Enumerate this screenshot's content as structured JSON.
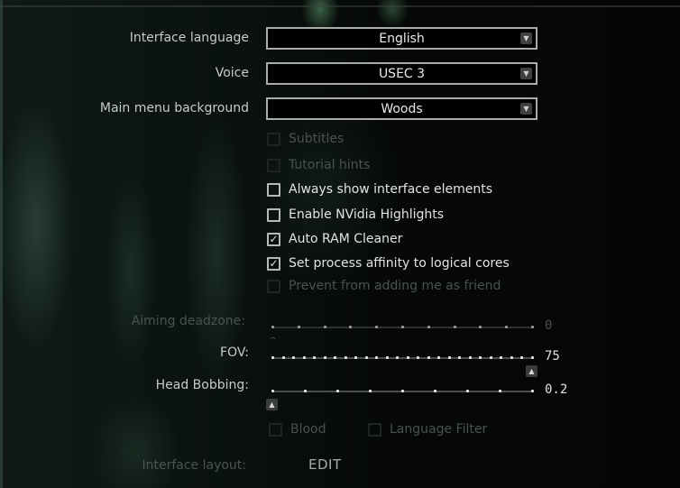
{
  "dropdowns": [
    {
      "label": "Interface language",
      "value": "English",
      "icon": "chevron-down-icon"
    },
    {
      "label": "Voice",
      "value": "USEC 3",
      "icon": "chevron-down-icon"
    },
    {
      "label": "Main menu background",
      "value": "Woods",
      "icon": "chevron-down-icon"
    }
  ],
  "checkboxes": [
    {
      "label": "Subtitles",
      "checked": false,
      "enabled": false
    },
    {
      "label": "Tutorial hints",
      "checked": false,
      "enabled": false
    },
    {
      "label": "Always show interface elements",
      "checked": false,
      "enabled": true
    },
    {
      "label": "Enable NVidia Highlights",
      "checked": false,
      "enabled": true
    },
    {
      "label": "Auto RAM Cleaner",
      "checked": true,
      "enabled": true
    },
    {
      "label": "Set process affinity to logical cores",
      "checked": true,
      "enabled": true
    },
    {
      "label": "Prevent from adding me as friend",
      "checked": false,
      "enabled": false
    }
  ],
  "check_glyph": "✓",
  "sliders": [
    {
      "label": "Aiming deadzone:",
      "value": "0",
      "ticks": 11,
      "position": 0.0,
      "enabled": false
    },
    {
      "label": "FOV:",
      "value": "75",
      "ticks": 26,
      "position": 1.0,
      "enabled": true
    },
    {
      "label": "Head Bobbing:",
      "value": "0.2",
      "ticks": 9,
      "position": 0.0,
      "enabled": true
    }
  ],
  "handle_glyph": "▲",
  "bottom_checkboxes": [
    {
      "label": "Blood",
      "checked": false,
      "enabled": false
    },
    {
      "label": "Language Filter",
      "checked": false,
      "enabled": false
    }
  ],
  "interface_layout": {
    "label": "Interface layout:",
    "button": "EDIT"
  },
  "arrow_glyph": "⌄"
}
